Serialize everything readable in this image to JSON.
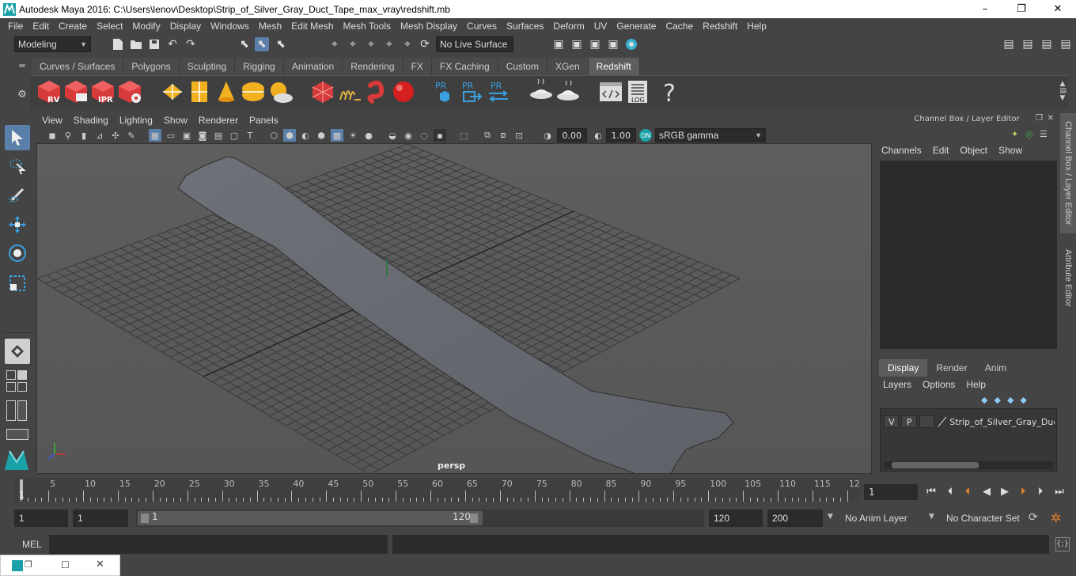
{
  "window": {
    "title": "Autodesk Maya 2016: C:\\Users\\lenov\\Desktop\\Strip_of_Silver_Gray_Duct_Tape_max_vray\\redshift.mb",
    "minimize": "–",
    "maximize": "❐",
    "close": "✕"
  },
  "menubar": [
    "File",
    "Edit",
    "Create",
    "Select",
    "Modify",
    "Display",
    "Windows",
    "Mesh",
    "Edit Mesh",
    "Mesh Tools",
    "Mesh Display",
    "Curves",
    "Surfaces",
    "Deform",
    "UV",
    "Generate",
    "Cache",
    "Redshift",
    "Help"
  ],
  "statusline": {
    "mode": "Modeling",
    "live_surface": "No Live Surface"
  },
  "shelf_tabs": [
    "Curves / Surfaces",
    "Polygons",
    "Sculpting",
    "Rigging",
    "Animation",
    "Rendering",
    "FX",
    "FX Caching",
    "Custom",
    "XGen",
    "Redshift"
  ],
  "shelf_active": "Redshift",
  "shelf_labels": {
    "rv": "RV",
    "ipr": "IPR",
    "pr": "PR",
    "log": "LOG",
    "help": "?"
  },
  "viewport": {
    "menu": [
      "View",
      "Shading",
      "Lighting",
      "Show",
      "Renderer",
      "Panels"
    ],
    "exposure": "0.00",
    "gamma": "1.00",
    "colorspace": "sRGB gamma",
    "camera": "persp"
  },
  "right_panel": {
    "header": "Channel Box / Layer Editor",
    "channel_menu": [
      "Channels",
      "Edit",
      "Object",
      "Show"
    ],
    "layer_tabs": [
      "Display",
      "Render",
      "Anim"
    ],
    "layer_tab_active": "Display",
    "layer_menu": [
      "Layers",
      "Options",
      "Help"
    ],
    "layer": {
      "v": "V",
      "p": "P",
      "name": "Strip_of_Silver_Gray_Duc"
    }
  },
  "side_tabs": [
    "Channel Box / Layer Editor",
    "Attribute Editor"
  ],
  "timeline": {
    "ticks": [
      "5",
      "10",
      "15",
      "20",
      "25",
      "30",
      "35",
      "40",
      "45",
      "50",
      "55",
      "60",
      "65",
      "70",
      "75",
      "80",
      "85",
      "90",
      "95",
      "100",
      "105",
      "110",
      "115",
      "12"
    ],
    "current_marker": "1",
    "current_frame": "1"
  },
  "range": {
    "start": "1",
    "playback_start": "1",
    "handle_start": "1",
    "handle_end": "120",
    "playback_end": "120",
    "end": "200",
    "anim_layer": "No Anim Layer",
    "char_set": "No Character Set"
  },
  "cmdline": {
    "label": "MEL"
  }
}
